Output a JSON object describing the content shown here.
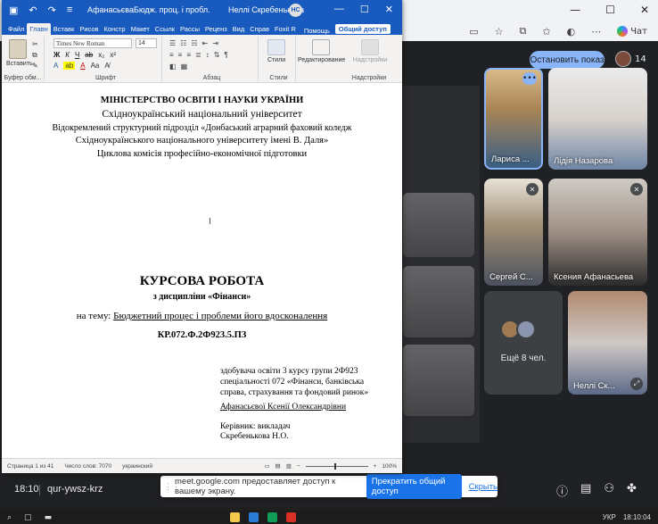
{
  "word": {
    "doc_title": "АфанасьєваБюдж. проц. і пробл. його вдоск...",
    "user_name": "Неллі Скребенькова",
    "user_initials": "НС",
    "tabs": [
      "Файл",
      "Главн",
      "Вставк",
      "Рисов",
      "Констр",
      "Макет",
      "Ссылк",
      "Рассы",
      "Реценз",
      "Вид",
      "Справ",
      "Foxit R"
    ],
    "help": "Помощь",
    "share": "Общий доступ",
    "ribbon": {
      "paste": "Вставить",
      "font_name": "Times New Roman",
      "font_size": "14",
      "styles": "Стили",
      "editing": "Редактирование",
      "addins": "Надстройки",
      "group_clipboard": "Буфер обм...",
      "group_font": "Шрифт",
      "group_paragraph": "Абзац",
      "group_styles": "Стили",
      "group_addins": "Надстройки"
    },
    "doc": {
      "line1": "МІНІСТЕРСТВО ОСВІТИ І НАУКИ УКРАЇНИ",
      "line2": "Східноукраїнський національний  університет",
      "line3": "Відокремлений структурний підрозділ «Донбаський аграрний фаховий  коледж",
      "line4": "Східноукраїнського національного університету імені В. Даля»",
      "line5": "Циклова комісія професійно-економічної підготовки",
      "cursor": "I",
      "title": "КУРСОВА РОБОТА",
      "discipline": "з дисципліни «Фінанси»",
      "topic_prefix": "на тему: ",
      "topic": "Бюджетний процес і проблеми його вдосконалення",
      "code": "КР.072.Ф.2Ф923.5.ПЗ",
      "student1": "здобувача освіти 3 курсу групи 2Ф923",
      "student2": "спеціальності 072 «Фінанси, банківська",
      "student3": "справа, страхування та фондовий ринок»",
      "student_name": "Афанасьєвої Ксенії Олександрівни",
      "supervisor1": "Керівник: викладач",
      "supervisor2": "Скребенькова  Н.О."
    },
    "status": {
      "page": "Страница 1 из 41",
      "words": "Число слов: 7070",
      "lang": "украинский",
      "zoom": "100%"
    }
  },
  "meet": {
    "stop_show": "Остановить показ",
    "participants_count": "14",
    "chat": "Чат",
    "tiles": [
      {
        "name": "Лариса ..."
      },
      {
        "name": "Лідія Назарова"
      },
      {
        "name": "Сергей С..."
      },
      {
        "name": "Ксения Афанасьева"
      },
      {
        "name": "Ещё 8 чел."
      },
      {
        "name": "Неллі Ск..."
      }
    ],
    "time": "18:10",
    "meeting_code": "qur-ywsz-krz",
    "share_notice": "meet.google.com предоставляет доступ к вашему экрану.",
    "share_button": "Прекратить общий доступ",
    "hide_link": "Скрыть"
  },
  "taskbar": {
    "lang": "УКР",
    "clock": "18:10:04"
  }
}
